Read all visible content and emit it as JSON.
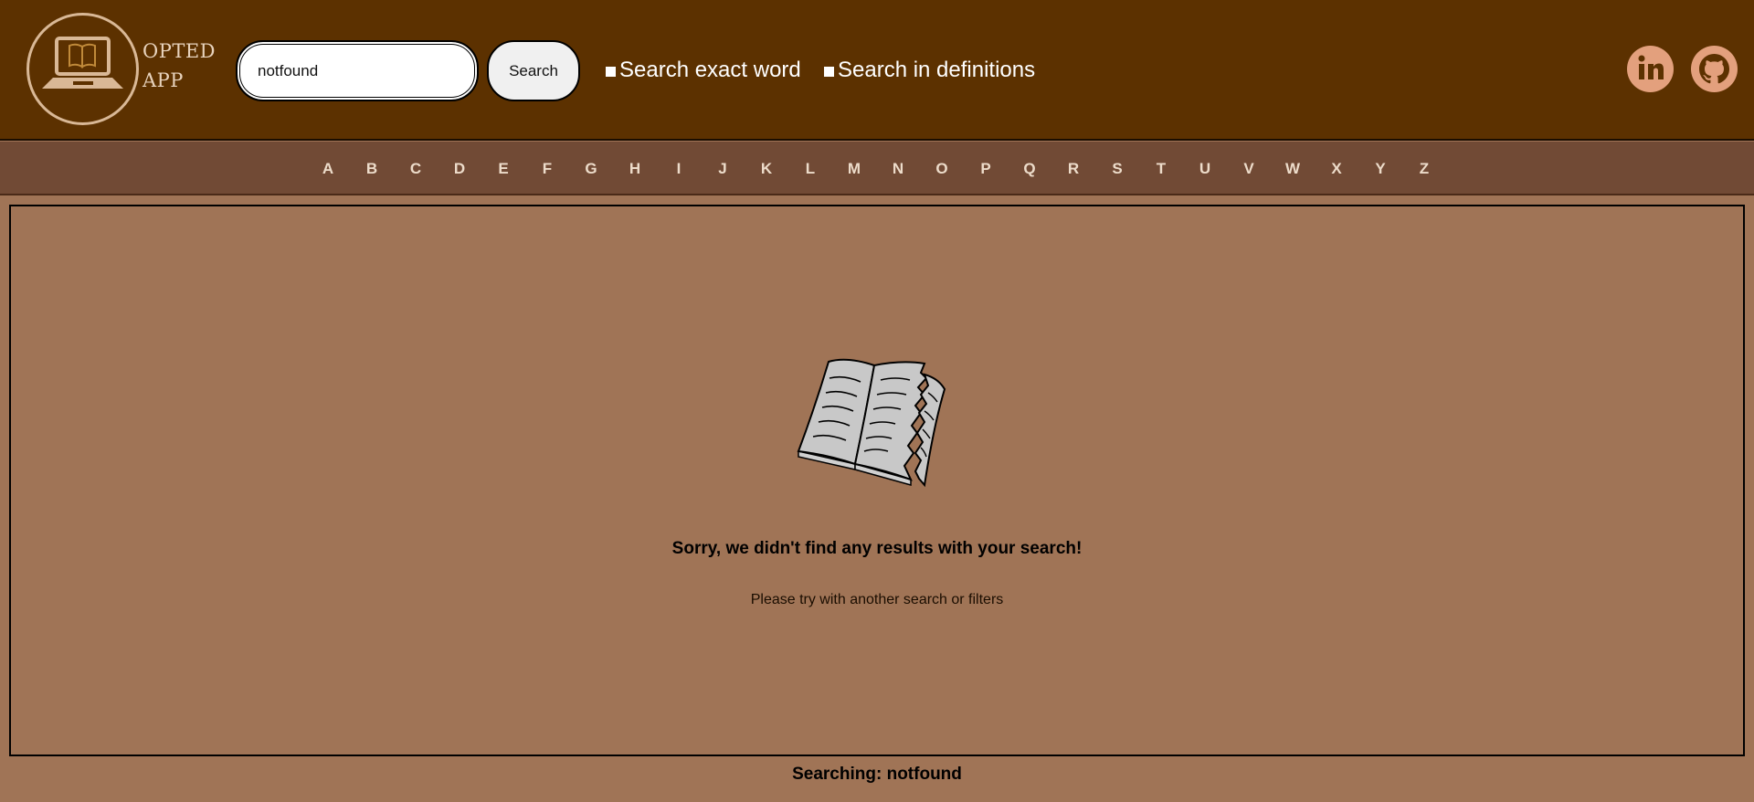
{
  "header": {
    "logo": {
      "icon": "laptop-book-icon",
      "line1": "OPTED",
      "line2": "APP"
    },
    "search": {
      "value": "notfound",
      "button_label": "Search"
    },
    "filters": [
      {
        "label": "Search exact word",
        "checked": true
      },
      {
        "label": "Search in definitions",
        "checked": true
      }
    ],
    "social": [
      {
        "icon": "linkedin-icon"
      },
      {
        "icon": "github-icon"
      }
    ]
  },
  "alphabet": [
    "A",
    "B",
    "C",
    "D",
    "E",
    "F",
    "G",
    "H",
    "I",
    "J",
    "K",
    "L",
    "M",
    "N",
    "O",
    "P",
    "Q",
    "R",
    "S",
    "T",
    "U",
    "V",
    "W",
    "X",
    "Y",
    "Z"
  ],
  "results": {
    "illustration": "torn-book-icon",
    "title": "Sorry, we didn't find any results with your search!",
    "subtitle": "Please try with another search or filters"
  },
  "status": {
    "label": "Searching:",
    "query": "notfound"
  },
  "colors": {
    "header_bg": "#5c3100",
    "alphabet_bg": "#714a35",
    "content_bg": "#a07456",
    "logo_stroke": "#d9b896",
    "social_bg": "#e3a07d"
  }
}
